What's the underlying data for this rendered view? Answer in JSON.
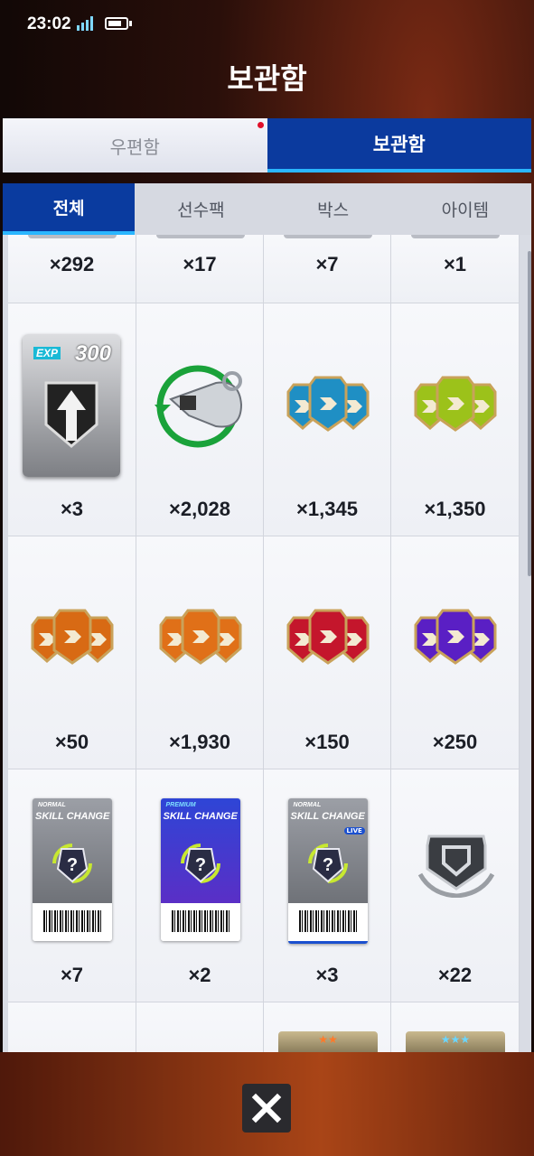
{
  "status": {
    "time": "23:02"
  },
  "title": "보관함",
  "top_tabs": [
    {
      "label": "우편함",
      "active": false,
      "has_notification": true
    },
    {
      "label": "보관함",
      "active": true
    }
  ],
  "sub_tabs": [
    {
      "label": "전체",
      "active": true
    },
    {
      "label": "선수팩",
      "active": false
    },
    {
      "label": "박스",
      "active": false
    },
    {
      "label": "아이템",
      "active": false
    }
  ],
  "items": [
    {
      "count": "×292",
      "icon": "partial-item-icon"
    },
    {
      "count": "×17",
      "icon": "partial-item-icon"
    },
    {
      "count": "×7",
      "icon": "partial-item-icon"
    },
    {
      "count": "×1",
      "icon": "partial-item-icon"
    },
    {
      "count": "×3",
      "icon": "exp-card-icon",
      "label": "EXP",
      "value": "300"
    },
    {
      "count": "×2,028",
      "icon": "whistle-icon"
    },
    {
      "count": "×1,345",
      "icon": "blue-gem-triple-icon",
      "color": "#1f8fc4"
    },
    {
      "count": "×1,350",
      "icon": "lime-gem-triple-icon",
      "color": "#9cc21a"
    },
    {
      "count": "×50",
      "icon": "orange-gem-triple-icon",
      "color": "#d86a14"
    },
    {
      "count": "×1,930",
      "icon": "orange-gem-triple-icon",
      "color": "#e07018"
    },
    {
      "count": "×150",
      "icon": "red-gem-triple-icon",
      "color": "#c4162c"
    },
    {
      "count": "×250",
      "icon": "purple-gem-triple-icon",
      "color": "#5a1fc4"
    },
    {
      "count": "×7",
      "icon": "skill-change-ticket-icon",
      "tier": "NORMAL",
      "name": "SKILL CHANGE",
      "theme": "#8a8d94"
    },
    {
      "count": "×2",
      "icon": "skill-change-ticket-icon",
      "tier": "PREMIUM",
      "name": "SKILL CHANGE",
      "theme": "#2a3fd0"
    },
    {
      "count": "×3",
      "icon": "skill-change-ticket-icon",
      "tier": "NORMAL",
      "name": "SKILL CHANGE",
      "badge": "LIVE",
      "theme": "#8a8d94"
    },
    {
      "count": "×22",
      "icon": "shield-emblem-icon"
    }
  ],
  "colors": {
    "accent": "#0a3b9f",
    "underline": "#2ab6ff"
  },
  "close_icon": "close-icon"
}
